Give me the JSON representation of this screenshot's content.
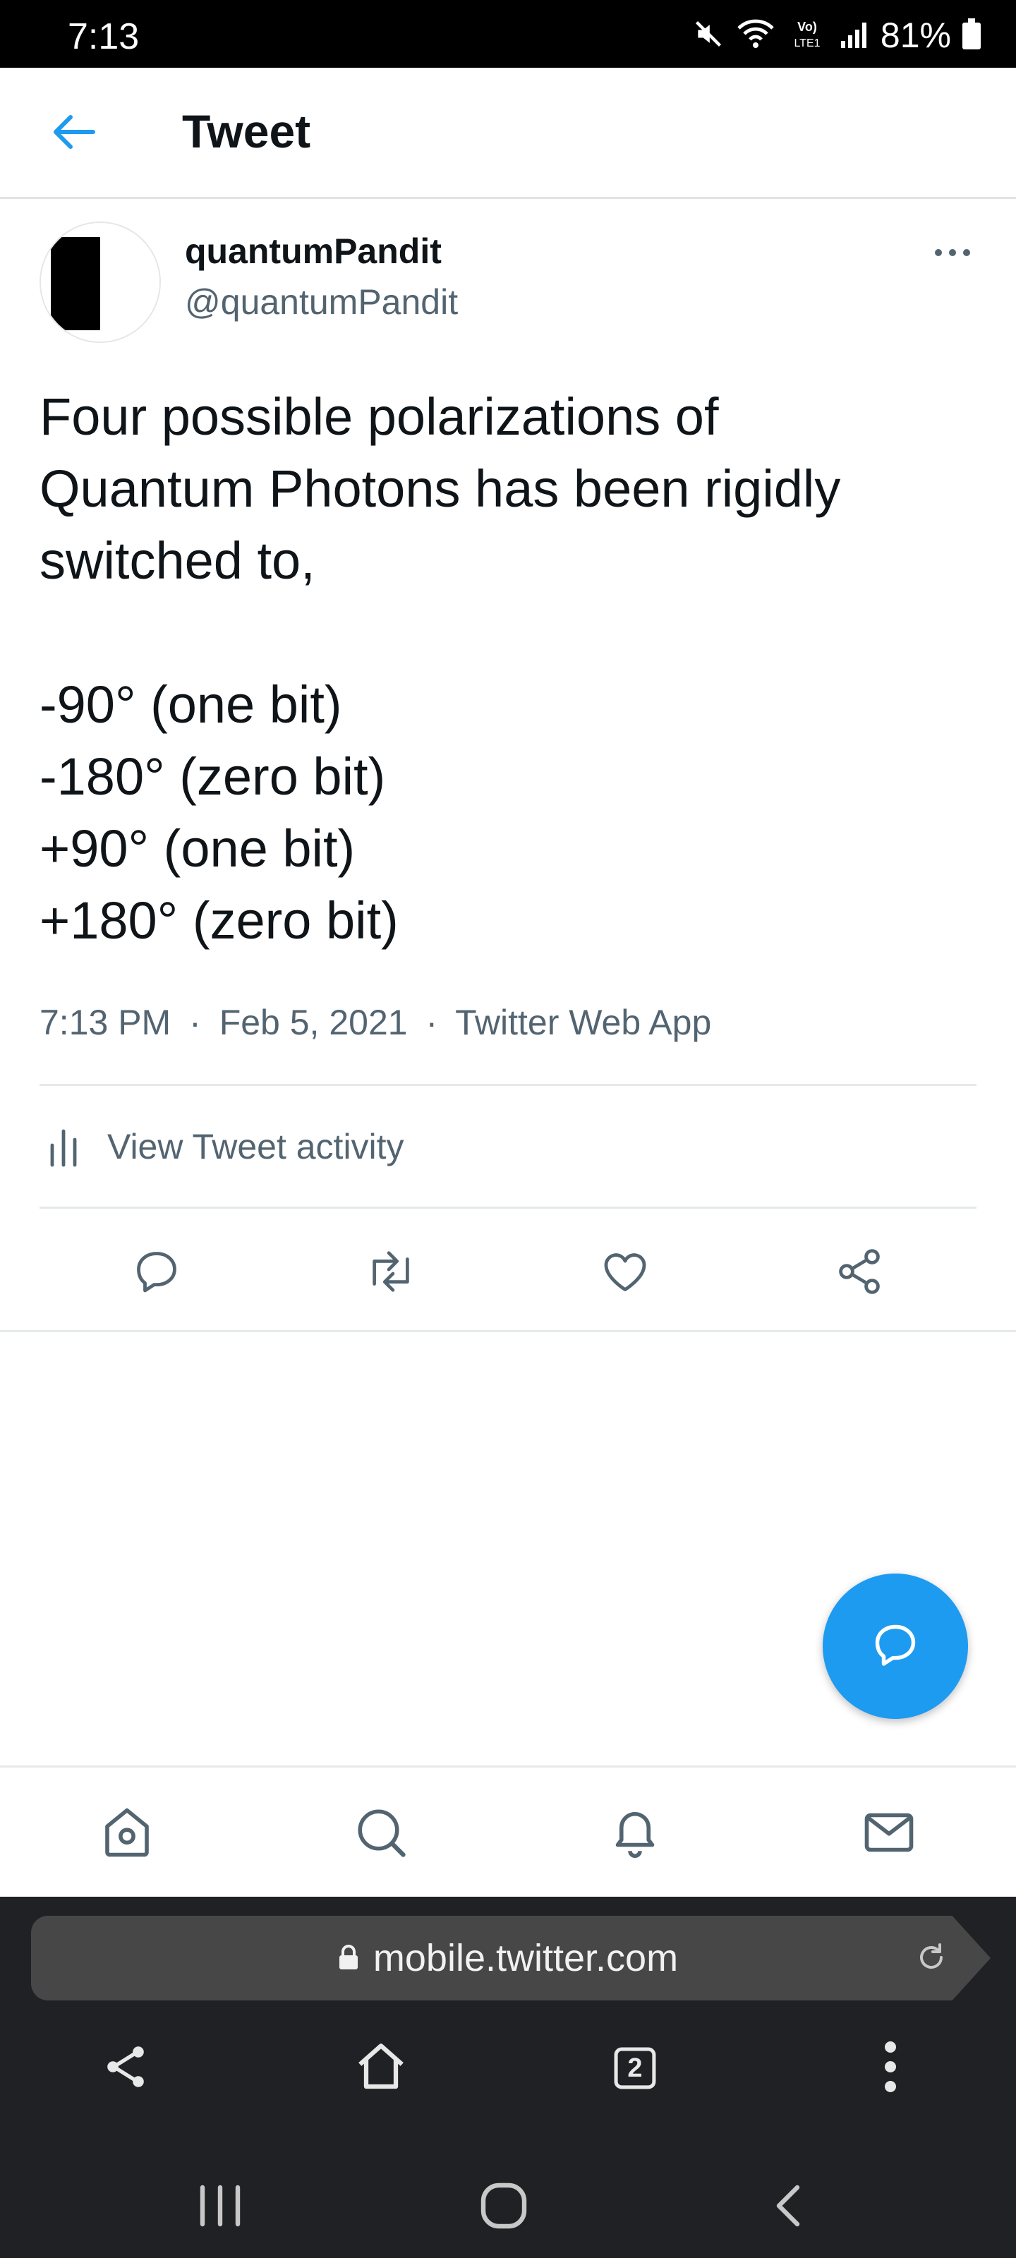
{
  "status_bar": {
    "time": "7:13",
    "battery": "81%",
    "icons": [
      "mute-icon",
      "wifi-icon",
      "volte-icon",
      "signal-icon",
      "battery-icon"
    ]
  },
  "header": {
    "title": "Tweet",
    "back_icon": "back-arrow-icon"
  },
  "tweet": {
    "author_name": "quantumPandit",
    "author_handle": "@quantumPandit",
    "text_lines": [
      "Four possible polarizations of",
      "Quantum Photons has been rigidly",
      "switched to,",
      "",
      "-90° (one bit)",
      "-180° (zero bit)",
      "+90° (one bit)",
      "+180° (zero bit)"
    ],
    "time": "7:13 PM",
    "date": "Feb 5, 2021",
    "source": "Twitter Web App",
    "separator": "·",
    "activity_label": "View Tweet activity"
  },
  "actions": [
    "reply-icon",
    "retweet-icon",
    "like-icon",
    "share-icon"
  ],
  "fab_icon": "compose-reply-icon",
  "bottom_nav": [
    "home-icon",
    "search-icon",
    "notifications-icon",
    "messages-icon"
  ],
  "browser": {
    "url": "mobile.twitter.com",
    "tab_count": "2"
  },
  "colors": {
    "accent": "#1d9bf0",
    "text_primary": "#0f1419",
    "text_secondary": "#536471",
    "status_bar_bg": "#000000",
    "browser_bg": "#202124",
    "url_bar_bg": "#474747"
  }
}
